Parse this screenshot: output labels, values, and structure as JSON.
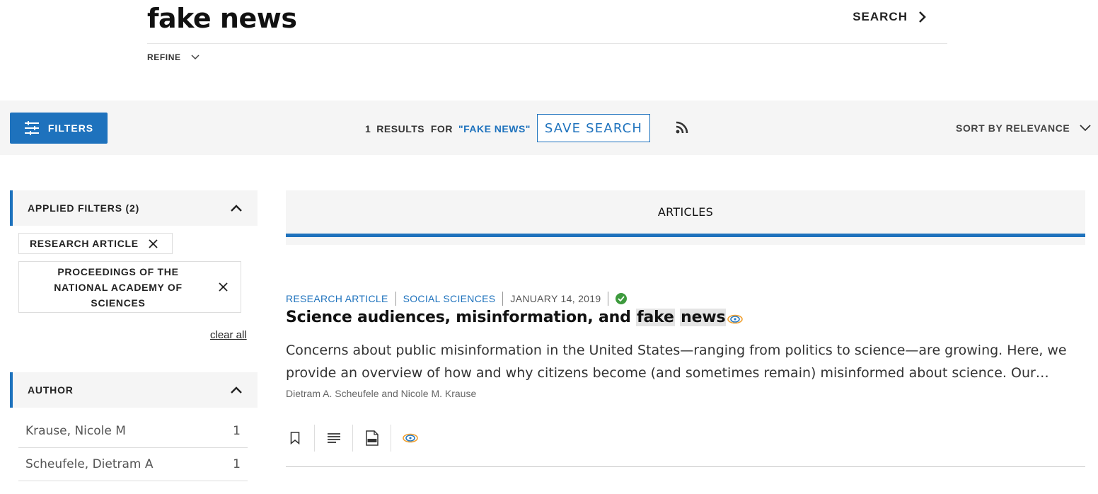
{
  "search": {
    "query": "fake news",
    "search_label": "SEARCH",
    "refine_label": "REFINE"
  },
  "toolbar": {
    "filters_label": "FILTERS",
    "result_count": "1",
    "results_for": "RESULTS  FOR",
    "query_quoted": "\"FAKE NEWS\"",
    "save_search_label": "SAVE SEARCH",
    "sort_label": "SORT BY RELEVANCE"
  },
  "sidebar": {
    "applied_filters_label": "APPLIED FILTERS (2)",
    "chips": [
      {
        "label": "RESEARCH ARTICLE"
      },
      {
        "label": "PROCEEDINGS OF THE NATIONAL ACADEMY OF SCIENCES"
      }
    ],
    "clear_all": "clear all",
    "author_label": "AUTHOR",
    "authors": [
      {
        "name": "Krause, Nicole M",
        "count": "1"
      },
      {
        "name": "Scheufele, Dietram A",
        "count": "1"
      }
    ]
  },
  "main": {
    "tab_label": "ARTICLES",
    "result": {
      "type": "RESEARCH ARTICLE",
      "section": "SOCIAL SCIENCES",
      "date": "JANUARY 14, 2019",
      "title_plain": "Science audiences, misinformation, and ",
      "title_hl1": "fake",
      "title_hl2": "news",
      "abstract": "Concerns about public misinformation in the United States—ranging from politics to science—are growing. Here, we provide an overview of how and why citizens become (and sometimes remain) misinformed about science. Our…",
      "authors": "Dietram A. Scheufele and Nicole M. Krause"
    }
  },
  "colors": {
    "accent": "#1e72bd",
    "verified": "#3d9a3d"
  }
}
